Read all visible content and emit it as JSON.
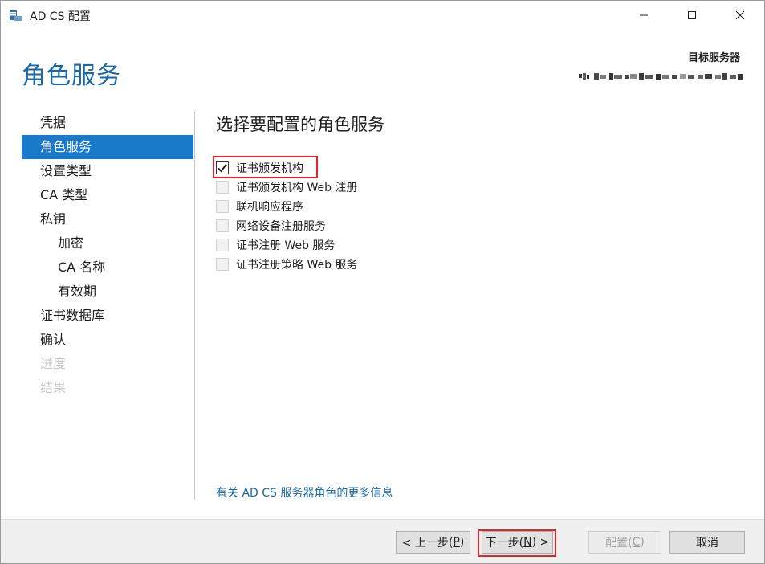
{
  "window": {
    "title": "AD CS 配置"
  },
  "header": {
    "page_title": "角色服务",
    "target_label": "目标服务器"
  },
  "nav": {
    "items": [
      {
        "label": "凭据",
        "state": "normal",
        "level": 0
      },
      {
        "label": "角色服务",
        "state": "active",
        "level": 0
      },
      {
        "label": "设置类型",
        "state": "normal",
        "level": 0
      },
      {
        "label": "CA 类型",
        "state": "normal",
        "level": 0
      },
      {
        "label": "私钥",
        "state": "normal",
        "level": 0
      },
      {
        "label": "加密",
        "state": "normal",
        "level": 1
      },
      {
        "label": "CA 名称",
        "state": "normal",
        "level": 1
      },
      {
        "label": "有效期",
        "state": "normal",
        "level": 1
      },
      {
        "label": "证书数据库",
        "state": "normal",
        "level": 0
      },
      {
        "label": "确认",
        "state": "normal",
        "level": 0
      },
      {
        "label": "进度",
        "state": "disabled",
        "level": 0
      },
      {
        "label": "结果",
        "state": "disabled",
        "level": 0
      }
    ]
  },
  "content": {
    "section_title": "选择要配置的角色服务",
    "options": [
      {
        "label": "证书颁发机构",
        "checked": true
      },
      {
        "label": "证书颁发机构 Web 注册",
        "checked": false
      },
      {
        "label": "联机响应程序",
        "checked": false
      },
      {
        "label": "网络设备注册服务",
        "checked": false
      },
      {
        "label": "证书注册 Web 服务",
        "checked": false
      },
      {
        "label": "证书注册策略 Web 服务",
        "checked": false
      }
    ],
    "more_info": "有关 AD CS 服务器角色的更多信息"
  },
  "footer": {
    "prev": {
      "pre": "< 上一步(",
      "key": "P",
      "post": ")"
    },
    "next": {
      "pre": "下一步(",
      "key": "N",
      "post": ") >"
    },
    "config": {
      "pre": "配置(",
      "key": "C",
      "post": ")"
    },
    "cancel": "取消"
  },
  "colors": {
    "accent": "#1979ca",
    "title_blue": "#1a67a8",
    "highlight_red": "#e0252b"
  }
}
